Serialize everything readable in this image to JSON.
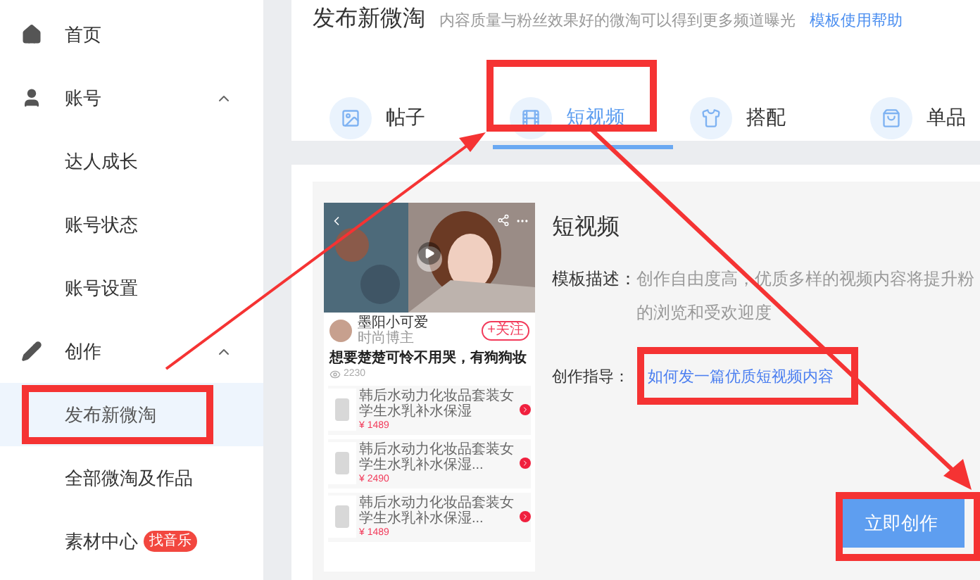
{
  "sidebar": {
    "items": [
      {
        "label": "首页",
        "kind": "link",
        "selected": false
      },
      {
        "label": "账号",
        "kind": "group",
        "expanded": true,
        "selected": false
      },
      {
        "label": "达人成长",
        "kind": "sub",
        "selected": false
      },
      {
        "label": "账号状态",
        "kind": "sub",
        "selected": false
      },
      {
        "label": "账号设置",
        "kind": "sub",
        "selected": false
      },
      {
        "label": "创作",
        "kind": "group",
        "expanded": true,
        "selected": false
      },
      {
        "label": "发布新微淘",
        "kind": "sub",
        "selected": true
      },
      {
        "label": "全部微淘及作品",
        "kind": "sub",
        "selected": false
      },
      {
        "label": "素材中心",
        "kind": "sub",
        "selected": false,
        "badge": "找音乐"
      }
    ]
  },
  "header": {
    "title": "发布新微淘",
    "subtitle": "内容质量与粉丝效果好的微淘可以得到更多频道曝光",
    "help_link": "模板使用帮助"
  },
  "tabs": [
    {
      "label": "帖子",
      "selected": false
    },
    {
      "label": "短视频",
      "selected": true
    },
    {
      "label": "搭配",
      "selected": false
    },
    {
      "label": "单品",
      "selected": false
    }
  ],
  "preview": {
    "author": "墨阳小可爱",
    "author_role": "时尚博主",
    "follow": "+关注",
    "post_title": "想要楚楚可怜不用哭，有狗狗妆",
    "views": "2230",
    "products": [
      {
        "name": "韩后水动力化妆品套装女学生水乳补水保湿",
        "price": "¥ 1489"
      },
      {
        "name": "韩后水动力化妆品套装女学生水乳补水保湿...",
        "price": "¥ 2490"
      },
      {
        "name": "韩后水动力化妆品套装女学生水乳补水保湿...",
        "price": "¥ 1489"
      }
    ]
  },
  "template": {
    "title": "短视频",
    "desc_label": "模板描述：",
    "desc": "创作自由度高，优质多样的视频内容将提升粉",
    "desc_line2": "的浏览和受欢迎度",
    "guide_label": "创作指导：",
    "guide_link": "如何发一篇优质短视频内容",
    "button": "立即创作"
  }
}
